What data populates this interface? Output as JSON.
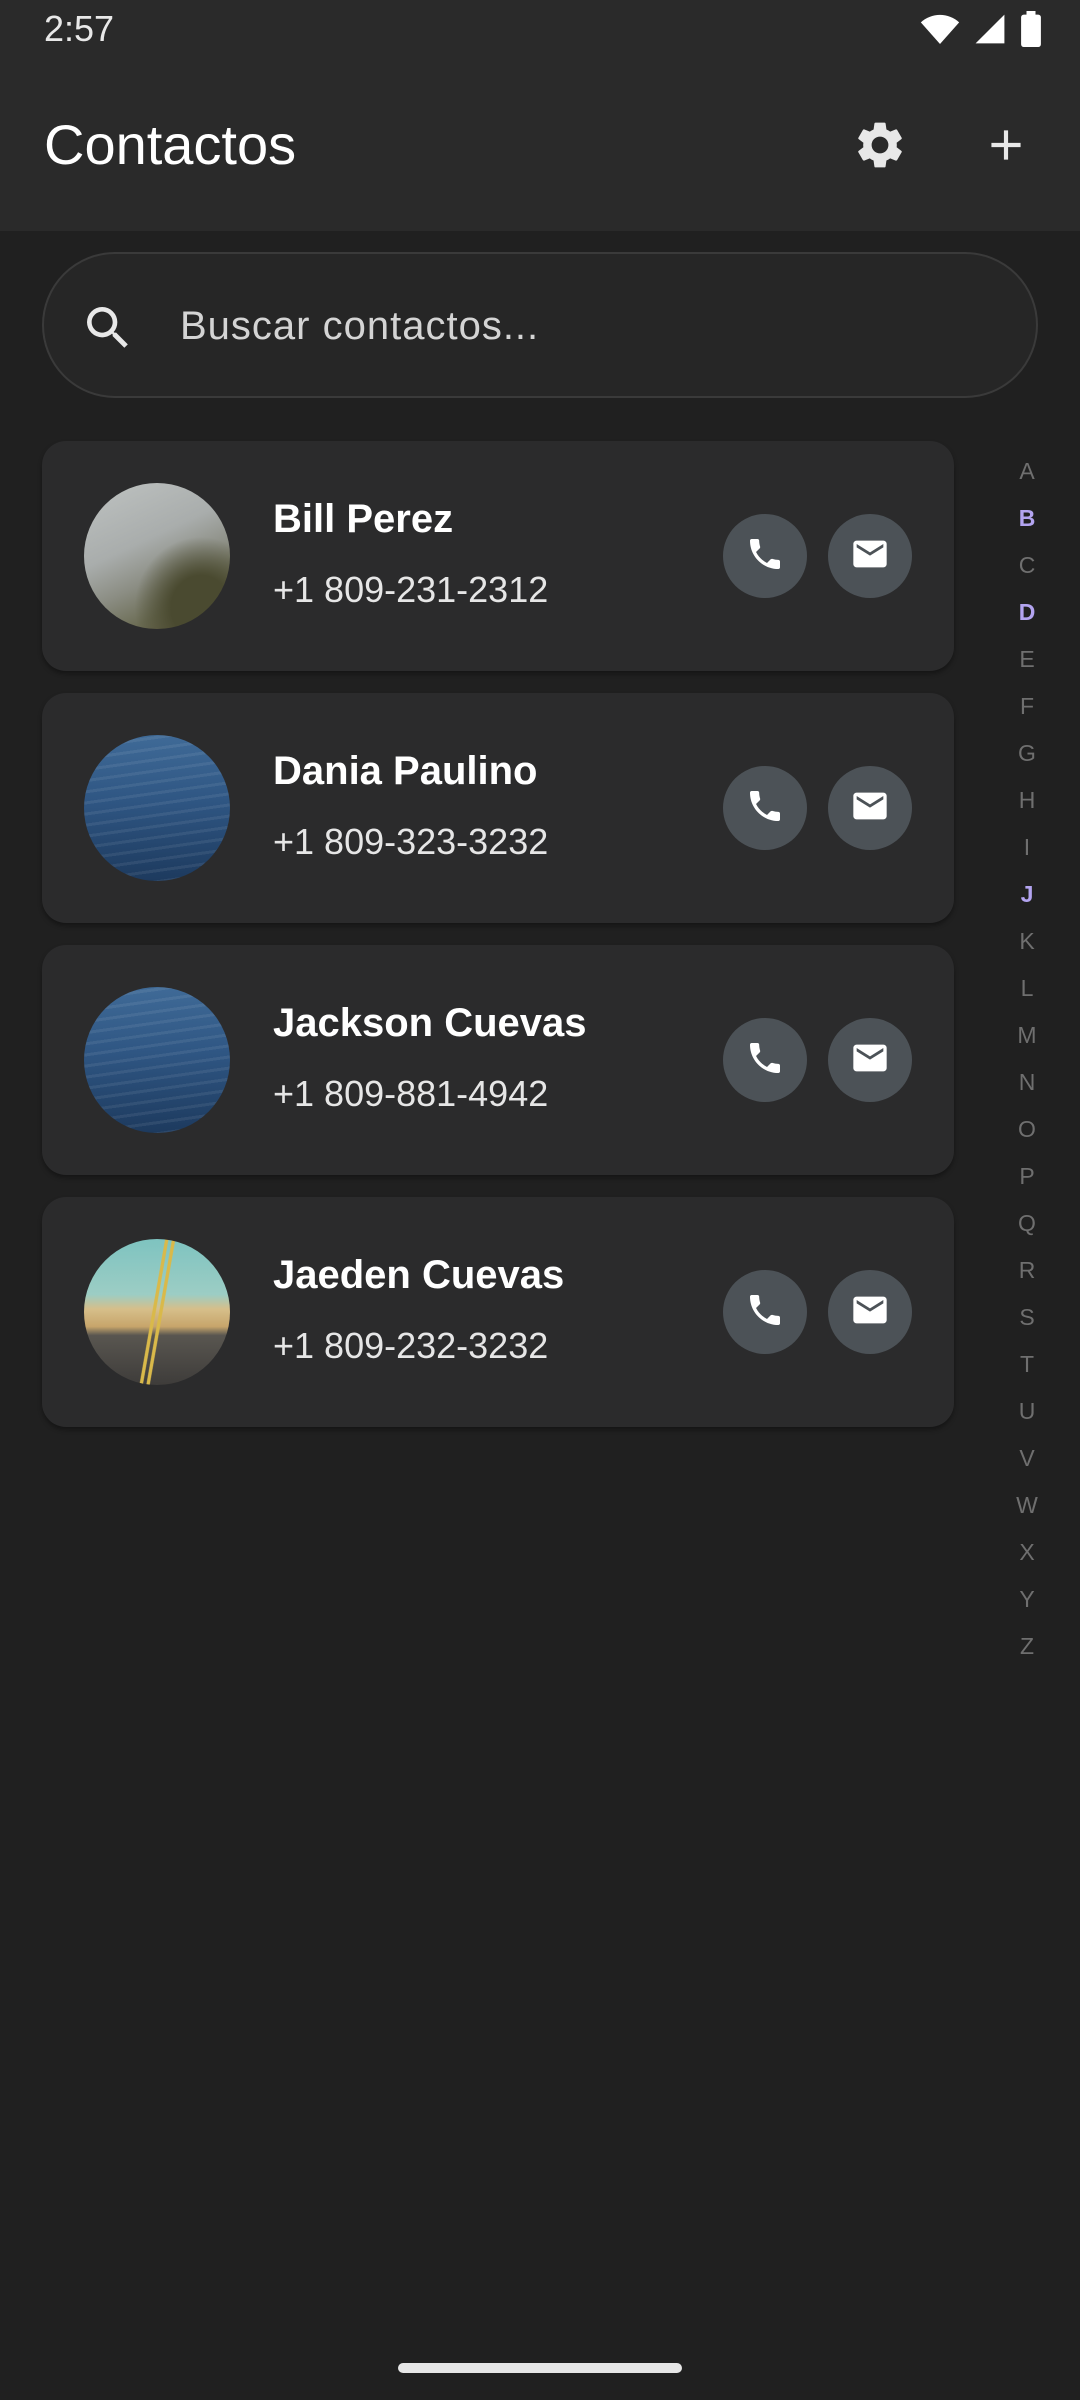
{
  "status_bar": {
    "time": "2:57",
    "icons": [
      "wifi-icon",
      "cell-signal-icon",
      "battery-icon"
    ]
  },
  "app_bar": {
    "title": "Contactos",
    "actions": [
      "gear-icon",
      "plus-icon"
    ]
  },
  "search": {
    "placeholder": "Buscar contactos...",
    "value": ""
  },
  "contacts": [
    {
      "name": "Bill Perez",
      "phone": "+1 809-231-2312",
      "avatar": "fog"
    },
    {
      "name": "Dania Paulino",
      "phone": "+1 809-323-3232",
      "avatar": "sea"
    },
    {
      "name": "Jackson Cuevas",
      "phone": "+1 809-881-4942",
      "avatar": "sea"
    },
    {
      "name": "Jaeden Cuevas",
      "phone": "+1 809-232-3232",
      "avatar": "road"
    }
  ],
  "alphabet": [
    "A",
    "B",
    "C",
    "D",
    "E",
    "F",
    "G",
    "H",
    "I",
    "J",
    "K",
    "L",
    "M",
    "N",
    "O",
    "P",
    "Q",
    "R",
    "S",
    "T",
    "U",
    "V",
    "W",
    "X",
    "Y",
    "Z"
  ],
  "alphabet_active": [
    "B",
    "D",
    "J"
  ],
  "colors": {
    "background": "#202020",
    "surface": "#2b2b2c",
    "action_button": "#4c5257",
    "accent_letter": "#b3a4f0"
  }
}
